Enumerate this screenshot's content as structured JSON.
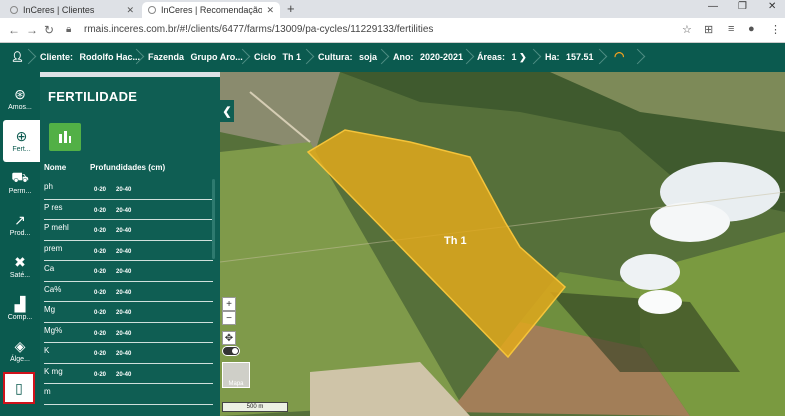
{
  "browser": {
    "tabs": [
      {
        "title": "InCeres | Clientes"
      },
      {
        "title": "InCeres | Recomendação"
      }
    ],
    "url": "rmais.inceres.com.br/#!/clients/6477/farms/13009/pa-cycles/11229133/fertilities"
  },
  "appbar": {
    "client_label": "Cliente:",
    "client_value": "Rodolfo Hac...",
    "farm_label": "Fazenda",
    "farm_value": "Grupo Aro...",
    "cycle_label": "Ciclo",
    "cycle_value": "Th 1",
    "crop_label": "Cultura:",
    "crop_value": "soja",
    "year_label": "Ano:",
    "year_value": "2020-2021",
    "areas_label": "Áreas:",
    "areas_value": "1",
    "ha_label": "Ha:",
    "ha_value": "157.51"
  },
  "rail": {
    "items": [
      {
        "label": "Amos...",
        "icon": "sample-icon"
      },
      {
        "label": "Fert...",
        "icon": "fertility-icon"
      },
      {
        "label": "Perm...",
        "icon": "tractor-icon"
      },
      {
        "label": "Prod...",
        "icon": "chart-line-icon"
      },
      {
        "label": "Saté...",
        "icon": "satellite-icon"
      },
      {
        "label": "Comp...",
        "icon": "factory-icon"
      },
      {
        "label": "Álge...",
        "icon": "layers-icon"
      },
      {
        "label": "",
        "icon": "device-icon"
      }
    ]
  },
  "panel": {
    "title": "FERTILIDADE",
    "col_name": "Nome",
    "col_depth": "Profundidades (cm)",
    "rows": [
      {
        "name": "ph",
        "d1": "0-20",
        "d2": "20-40"
      },
      {
        "name": "P res",
        "d1": "0-20",
        "d2": "20-40"
      },
      {
        "name": "P mehl",
        "d1": "0-20",
        "d2": "20-40"
      },
      {
        "name": "prem",
        "d1": "0-20",
        "d2": "20-40"
      },
      {
        "name": "Ca",
        "d1": "0-20",
        "d2": "20-40"
      },
      {
        "name": "Ca%",
        "d1": "0-20",
        "d2": "20-40"
      },
      {
        "name": "Mg",
        "d1": "0-20",
        "d2": "20-40"
      },
      {
        "name": "Mg%",
        "d1": "0-20",
        "d2": "20-40"
      },
      {
        "name": "K",
        "d1": "0-20",
        "d2": "20-40"
      },
      {
        "name": "K mg",
        "d1": "0-20",
        "d2": "20-40"
      },
      {
        "name": "m",
        "d1": "",
        "d2": ""
      }
    ]
  },
  "map": {
    "field_name": "Th 1",
    "field_color": "#e0a81c",
    "zoom_in": "+",
    "zoom_out": "−",
    "basemap_label": "Mapa",
    "scale": "500 m"
  },
  "colors": {
    "brand": "#0b5a4f",
    "accent": "#52b046",
    "highlight": "#d0121b"
  }
}
